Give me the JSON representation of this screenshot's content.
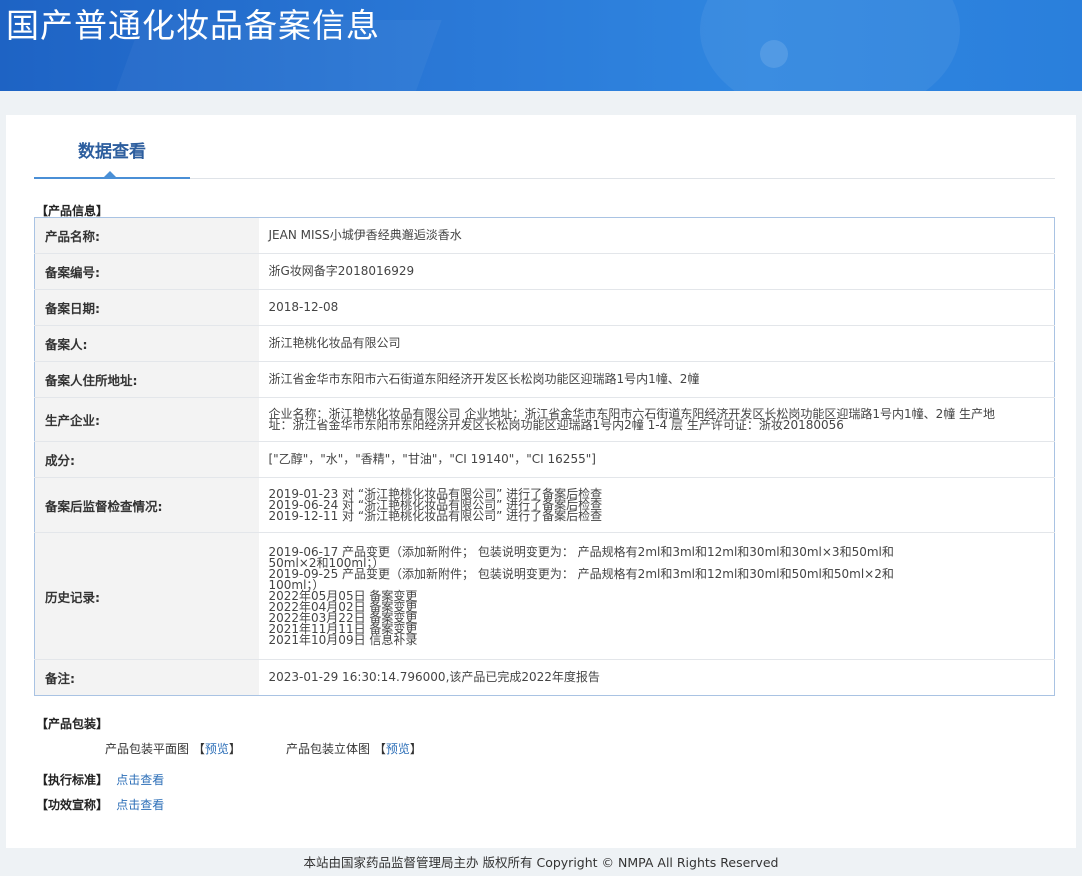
{
  "banner": {
    "title": "国产普通化妆品备案信息"
  },
  "tabs": [
    {
      "label": "数据查看"
    }
  ],
  "product_info": {
    "heading": "【产品信息】",
    "rows": [
      {
        "key": "产品名称:",
        "value": "JEAN MISS小城伊香经典邂逅淡香水"
      },
      {
        "key": "备案编号:",
        "value": "浙G妆网备字2018016929"
      },
      {
        "key": "备案日期:",
        "value": "2018-12-08"
      },
      {
        "key": "备案人:",
        "value": "浙江艳桃化妆品有限公司"
      },
      {
        "key": "备案人住所地址:",
        "value": "浙江省金华市东阳市六石街道东阳经济开发区长松岗功能区迎瑞路1号内1幢、2幢"
      },
      {
        "key": "生产企业:",
        "value": "企业名称：浙江艳桃化妆品有限公司 企业地址：浙江省金华市东阳市六石街道东阳经济开发区长松岗功能区迎瑞路1号内1幢、2幢 生产地\n址：浙江省金华市东阳市东阳经济开发区长松岗功能区迎瑞路1号内2幢 1-4 层 生产许可证：浙妆20180056"
      },
      {
        "key": "成分:",
        "value": "[\"乙醇\"，\"水\"，\"香精\"，\"甘油\"，\"CI 19140\"，\"CI 16255\"]"
      },
      {
        "key": "备案后监督检查情况:",
        "value": "2019-01-23 对 “浙江艳桃化妆品有限公司” 进行了备案后检查\n2019-06-24 对 “浙江艳桃化妆品有限公司” 进行了备案后检查\n2019-12-11 对 “浙江艳桃化妆品有限公司” 进行了备案后检查"
      },
      {
        "key": "历史记录:",
        "value": "2019-06-17 产品变更（添加新附件；  包装说明变更为：  产品规格有2ml和3ml和12ml和30ml和30ml×3和50ml和\n50ml×2和100ml；）\n2019-09-25 产品变更（添加新附件；  包装说明变更为：  产品规格有2ml和3ml和12ml和30ml和50ml和50ml×2和\n100ml；）\n2022年05月05日 备案变更\n2022年04月02日 备案变更\n2022年03月22日 备案变更\n2021年11月11日 备案变更\n2021年10月09日 信息补录"
      },
      {
        "key": "备注:",
        "value": "2023-01-29 16:30:14.796000,该产品已完成2022年度报告"
      }
    ]
  },
  "packaging": {
    "heading": "【产品包装】",
    "flat_label": "产品包装平面图",
    "flat_link": "预览",
    "solid_label": "产品包装立体图",
    "solid_link": "预览",
    "bracket_open": "【",
    "bracket_close": "】"
  },
  "standard": {
    "heading": "【执行标准】",
    "link": "点击查看"
  },
  "efficacy": {
    "heading": "【功效宣称】",
    "link": "点击查看"
  },
  "footer": {
    "text": "本站由国家药品监督管理局主办 版权所有 Copyright © NMPA All Rights Reserved"
  }
}
